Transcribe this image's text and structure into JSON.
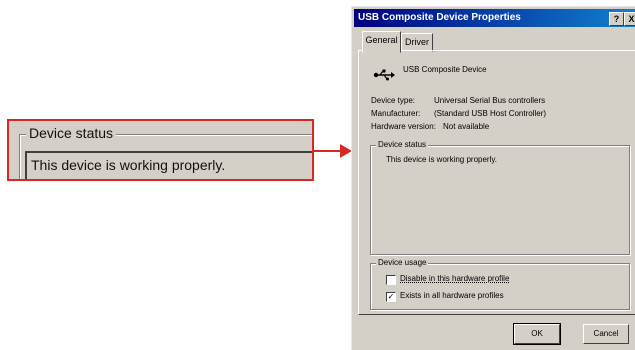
{
  "callout": {
    "legend": "Device status",
    "text": "This device is working properly."
  },
  "dialog": {
    "title": "USB Composite Device Properties",
    "title_buttons": {
      "help": "?",
      "close": "X"
    },
    "tabs": [
      {
        "label": "General"
      },
      {
        "label": "Driver"
      }
    ],
    "device_name": "USB Composite Device",
    "device_icon": "usb-icon",
    "properties": [
      {
        "label": "Device type:",
        "value": "Universal Serial Bus controllers"
      },
      {
        "label": "Manufacturer:",
        "value": "(Standard USB Host Controller)"
      },
      {
        "label": "Hardware version:",
        "value": "Not available"
      }
    ],
    "status": {
      "legend": "Device status",
      "text": "This device is working properly."
    },
    "usage": {
      "legend": "Device usage",
      "options": [
        {
          "label": "Disable in this hardware profile",
          "checked": false
        },
        {
          "label": "Exists in all hardware profiles",
          "checked": true
        }
      ]
    },
    "buttons": {
      "ok": "OK",
      "cancel": "Cancel"
    }
  },
  "colors": {
    "callout_border": "#d42a26",
    "titlebar": "#000080",
    "face": "#d4d0c8"
  }
}
